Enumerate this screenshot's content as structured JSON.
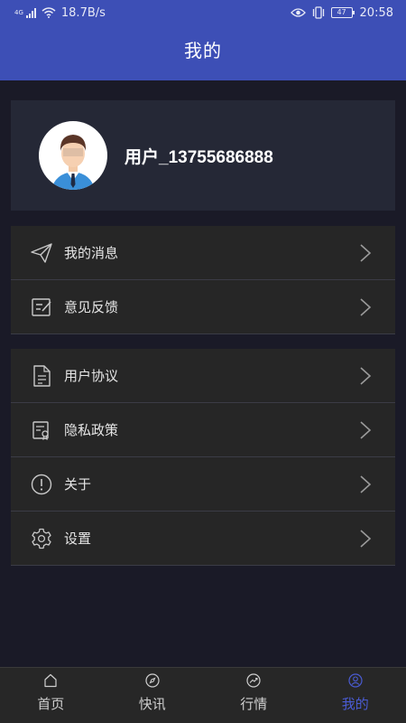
{
  "status_bar": {
    "network": "4G",
    "speed": "18.7B/s",
    "battery": "47",
    "time": "20:58"
  },
  "header": {
    "title": "我的"
  },
  "profile": {
    "username": "用户_13755686888"
  },
  "menu": {
    "group1": [
      {
        "label": "我的消息",
        "icon": "paper-plane-icon"
      },
      {
        "label": "意见反馈",
        "icon": "edit-feedback-icon"
      }
    ],
    "group2": [
      {
        "label": "用户协议",
        "icon": "document-icon"
      },
      {
        "label": "隐私政策",
        "icon": "certificate-icon"
      },
      {
        "label": "关于",
        "icon": "info-circle-icon"
      },
      {
        "label": "设置",
        "icon": "gear-icon"
      }
    ]
  },
  "tabs": [
    {
      "label": "首页",
      "icon": "home-icon"
    },
    {
      "label": "快讯",
      "icon": "compass-icon"
    },
    {
      "label": "行情",
      "icon": "trend-icon"
    },
    {
      "label": "我的",
      "icon": "user-icon",
      "active": true
    }
  ],
  "colors": {
    "header": "#3d4fb6",
    "background": "#1a1a27",
    "card": "#252836",
    "menu": "#262626",
    "tab_active": "#4a5bd2"
  }
}
